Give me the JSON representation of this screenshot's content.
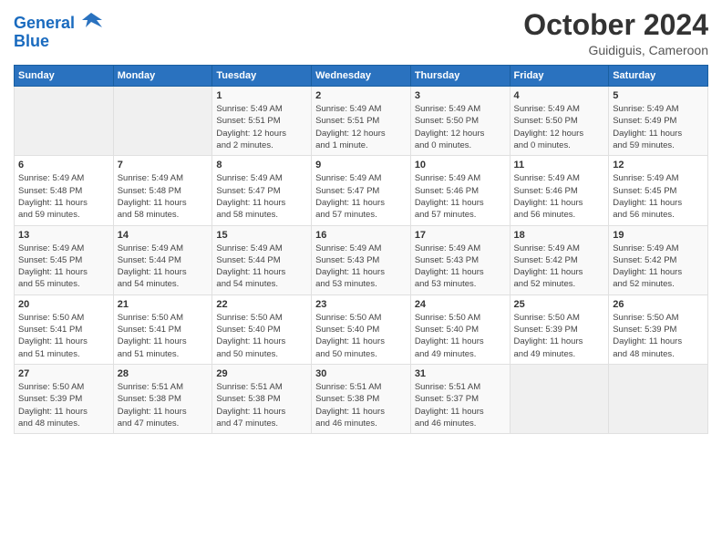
{
  "header": {
    "logo_line1": "General",
    "logo_line2": "Blue",
    "month": "October 2024",
    "location": "Guidiguis, Cameroon"
  },
  "weekdays": [
    "Sunday",
    "Monday",
    "Tuesday",
    "Wednesday",
    "Thursday",
    "Friday",
    "Saturday"
  ],
  "rows": [
    [
      {
        "day": "",
        "info": ""
      },
      {
        "day": "",
        "info": ""
      },
      {
        "day": "1",
        "info": "Sunrise: 5:49 AM\nSunset: 5:51 PM\nDaylight: 12 hours\nand 2 minutes."
      },
      {
        "day": "2",
        "info": "Sunrise: 5:49 AM\nSunset: 5:51 PM\nDaylight: 12 hours\nand 1 minute."
      },
      {
        "day": "3",
        "info": "Sunrise: 5:49 AM\nSunset: 5:50 PM\nDaylight: 12 hours\nand 0 minutes."
      },
      {
        "day": "4",
        "info": "Sunrise: 5:49 AM\nSunset: 5:50 PM\nDaylight: 12 hours\nand 0 minutes."
      },
      {
        "day": "5",
        "info": "Sunrise: 5:49 AM\nSunset: 5:49 PM\nDaylight: 11 hours\nand 59 minutes."
      }
    ],
    [
      {
        "day": "6",
        "info": "Sunrise: 5:49 AM\nSunset: 5:48 PM\nDaylight: 11 hours\nand 59 minutes."
      },
      {
        "day": "7",
        "info": "Sunrise: 5:49 AM\nSunset: 5:48 PM\nDaylight: 11 hours\nand 58 minutes."
      },
      {
        "day": "8",
        "info": "Sunrise: 5:49 AM\nSunset: 5:47 PM\nDaylight: 11 hours\nand 58 minutes."
      },
      {
        "day": "9",
        "info": "Sunrise: 5:49 AM\nSunset: 5:47 PM\nDaylight: 11 hours\nand 57 minutes."
      },
      {
        "day": "10",
        "info": "Sunrise: 5:49 AM\nSunset: 5:46 PM\nDaylight: 11 hours\nand 57 minutes."
      },
      {
        "day": "11",
        "info": "Sunrise: 5:49 AM\nSunset: 5:46 PM\nDaylight: 11 hours\nand 56 minutes."
      },
      {
        "day": "12",
        "info": "Sunrise: 5:49 AM\nSunset: 5:45 PM\nDaylight: 11 hours\nand 56 minutes."
      }
    ],
    [
      {
        "day": "13",
        "info": "Sunrise: 5:49 AM\nSunset: 5:45 PM\nDaylight: 11 hours\nand 55 minutes."
      },
      {
        "day": "14",
        "info": "Sunrise: 5:49 AM\nSunset: 5:44 PM\nDaylight: 11 hours\nand 54 minutes."
      },
      {
        "day": "15",
        "info": "Sunrise: 5:49 AM\nSunset: 5:44 PM\nDaylight: 11 hours\nand 54 minutes."
      },
      {
        "day": "16",
        "info": "Sunrise: 5:49 AM\nSunset: 5:43 PM\nDaylight: 11 hours\nand 53 minutes."
      },
      {
        "day": "17",
        "info": "Sunrise: 5:49 AM\nSunset: 5:43 PM\nDaylight: 11 hours\nand 53 minutes."
      },
      {
        "day": "18",
        "info": "Sunrise: 5:49 AM\nSunset: 5:42 PM\nDaylight: 11 hours\nand 52 minutes."
      },
      {
        "day": "19",
        "info": "Sunrise: 5:49 AM\nSunset: 5:42 PM\nDaylight: 11 hours\nand 52 minutes."
      }
    ],
    [
      {
        "day": "20",
        "info": "Sunrise: 5:50 AM\nSunset: 5:41 PM\nDaylight: 11 hours\nand 51 minutes."
      },
      {
        "day": "21",
        "info": "Sunrise: 5:50 AM\nSunset: 5:41 PM\nDaylight: 11 hours\nand 51 minutes."
      },
      {
        "day": "22",
        "info": "Sunrise: 5:50 AM\nSunset: 5:40 PM\nDaylight: 11 hours\nand 50 minutes."
      },
      {
        "day": "23",
        "info": "Sunrise: 5:50 AM\nSunset: 5:40 PM\nDaylight: 11 hours\nand 50 minutes."
      },
      {
        "day": "24",
        "info": "Sunrise: 5:50 AM\nSunset: 5:40 PM\nDaylight: 11 hours\nand 49 minutes."
      },
      {
        "day": "25",
        "info": "Sunrise: 5:50 AM\nSunset: 5:39 PM\nDaylight: 11 hours\nand 49 minutes."
      },
      {
        "day": "26",
        "info": "Sunrise: 5:50 AM\nSunset: 5:39 PM\nDaylight: 11 hours\nand 48 minutes."
      }
    ],
    [
      {
        "day": "27",
        "info": "Sunrise: 5:50 AM\nSunset: 5:39 PM\nDaylight: 11 hours\nand 48 minutes."
      },
      {
        "day": "28",
        "info": "Sunrise: 5:51 AM\nSunset: 5:38 PM\nDaylight: 11 hours\nand 47 minutes."
      },
      {
        "day": "29",
        "info": "Sunrise: 5:51 AM\nSunset: 5:38 PM\nDaylight: 11 hours\nand 47 minutes."
      },
      {
        "day": "30",
        "info": "Sunrise: 5:51 AM\nSunset: 5:38 PM\nDaylight: 11 hours\nand 46 minutes."
      },
      {
        "day": "31",
        "info": "Sunrise: 5:51 AM\nSunset: 5:37 PM\nDaylight: 11 hours\nand 46 minutes."
      },
      {
        "day": "",
        "info": ""
      },
      {
        "day": "",
        "info": ""
      }
    ]
  ]
}
